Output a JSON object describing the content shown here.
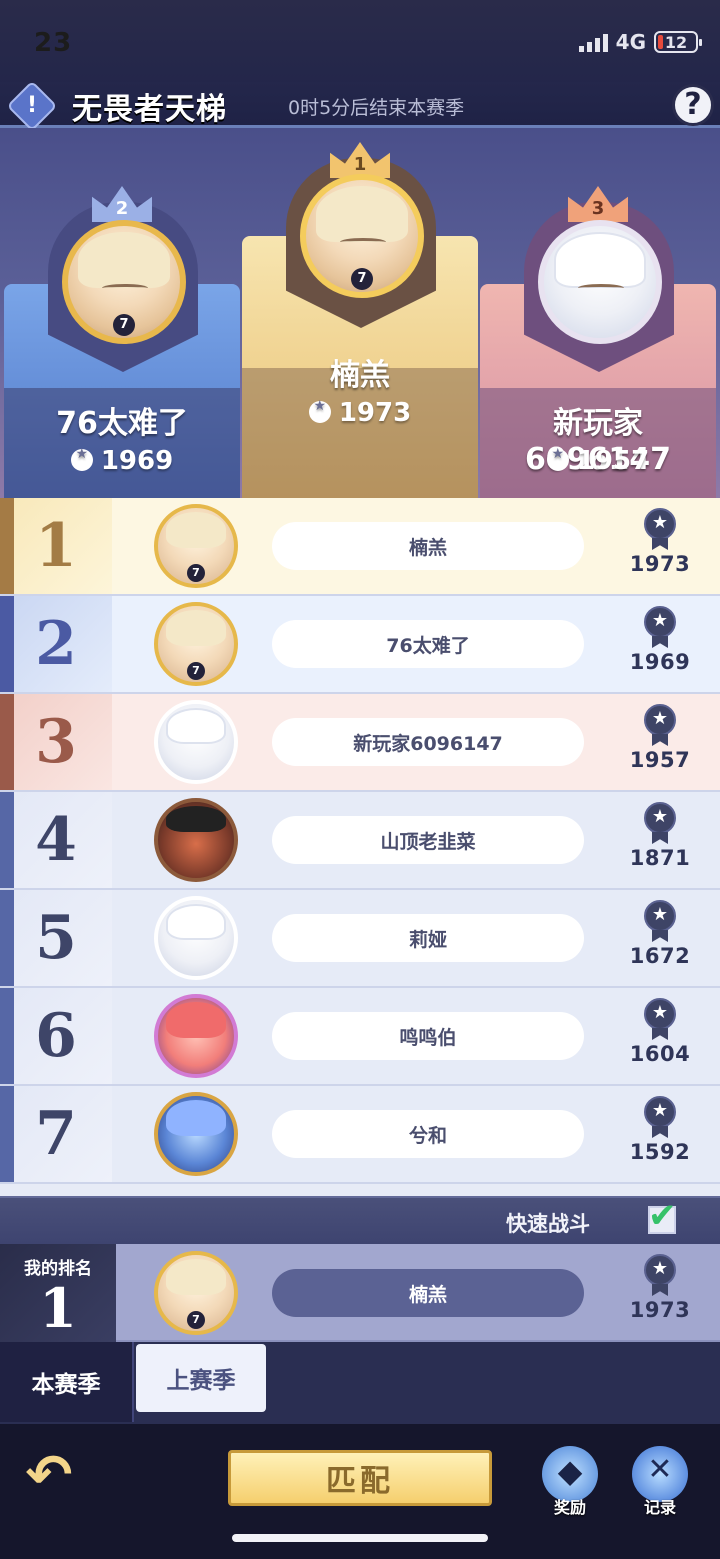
{
  "status_bar": {
    "time": "23",
    "network": "4G",
    "battery": "12"
  },
  "header": {
    "title": "无畏者天梯",
    "season_note": "0时5分后结束本赛季",
    "warn_icon": "!",
    "help_icon": "?"
  },
  "podium": {
    "first": {
      "rank": "1",
      "name": "楠羔",
      "score": "1973"
    },
    "second": {
      "rank": "2",
      "name": "76太难了",
      "score": "1969"
    },
    "third": {
      "rank": "3",
      "name": "新玩家6096147",
      "score": "1957"
    },
    "level_badge": "7"
  },
  "rankings": [
    {
      "rank": "1",
      "name": "楠羔",
      "score": "1973"
    },
    {
      "rank": "2",
      "name": "76太难了",
      "score": "1969"
    },
    {
      "rank": "3",
      "name": "新玩家6096147",
      "score": "1957"
    },
    {
      "rank": "4",
      "name": "山顶老韭菜",
      "score": "1871"
    },
    {
      "rank": "5",
      "name": "莉娅",
      "score": "1672"
    },
    {
      "rank": "6",
      "name": "鸣鸣伯",
      "score": "1604"
    },
    {
      "rank": "7",
      "name": "兮和",
      "score": "1592"
    }
  ],
  "quick_battle": {
    "label": "快速战斗",
    "checked": true,
    "check_mark": "✔"
  },
  "my_rank": {
    "label": "我的排名",
    "rank": "1",
    "name": "楠羔",
    "score": "1973"
  },
  "tabs": {
    "current": "本赛季",
    "previous": "上赛季"
  },
  "bottom": {
    "back_icon": "↶",
    "match_label": "匹配",
    "reward_label": "奖励",
    "record_label": "记录"
  }
}
